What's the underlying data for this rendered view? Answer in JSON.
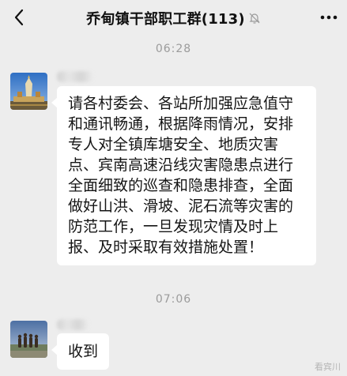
{
  "header": {
    "title": "乔甸镇干部职工群(113)",
    "back_icon": "chevron-left-icon",
    "mute_icon": "bell-off-icon",
    "more_icon": "more-dots-icon"
  },
  "messages": [
    {
      "time": "06:28",
      "avatar": "temple-pagoda-avatar",
      "text": "请各村委会、各站所加强应急值守和通讯畅通，根据降雨情况，安排专人对全镇库塘安全、地质灾害点、宾南高速沿线灾害隐患点进行全面细致的巡查和隐患排查，全面做好山洪、滑坡、泥石流等灾害的防范工作，一旦发现灾情及时上报、及时采取有效措施处置！"
    },
    {
      "time": "07:06",
      "avatar": "group-photo-avatar",
      "text": "收到"
    }
  ],
  "watermark": "看宾川",
  "colors": {
    "background": "#ededed",
    "bubble": "#ffffff",
    "timestamp": "#9b9b9b"
  }
}
